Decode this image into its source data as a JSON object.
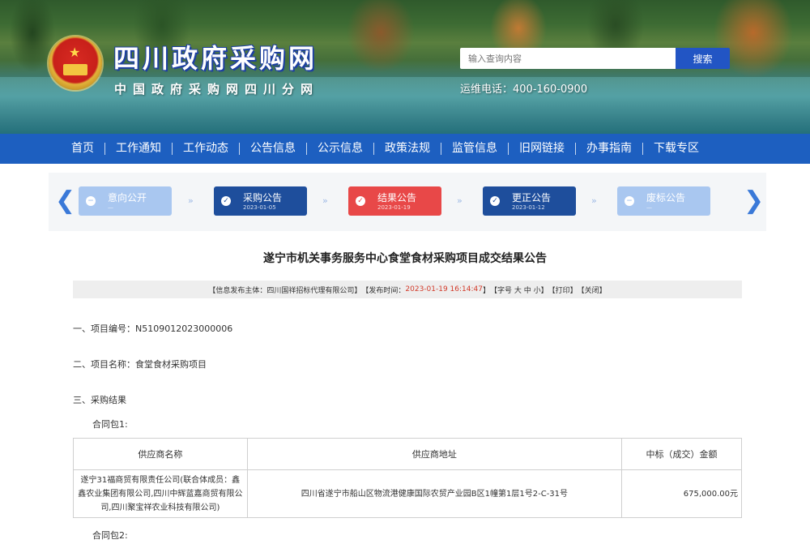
{
  "header": {
    "site_title": "四川政府采购网",
    "site_subtitle": "中国政府采购网四川分网",
    "search_placeholder": "输入查询内容",
    "search_button": "搜索",
    "hotline": "运维电话：400-160-0900"
  },
  "nav": {
    "items": [
      "首页",
      "工作通知",
      "工作动态",
      "公告信息",
      "公示信息",
      "政策法规",
      "监管信息",
      "旧网链接",
      "办事指南",
      "下载专区"
    ]
  },
  "steps": [
    {
      "label": "意向公开",
      "date": "—",
      "status": "gray"
    },
    {
      "label": "采购公告",
      "date": "2023-01-05",
      "status": "blue"
    },
    {
      "label": "结果公告",
      "date": "2023-01-19",
      "status": "red"
    },
    {
      "label": "更正公告",
      "date": "2023-01-12",
      "status": "blue"
    },
    {
      "label": "废标公告",
      "date": "—",
      "status": "gray"
    }
  ],
  "article": {
    "title": "遂宁市机关事务服务中心食堂食材采购项目成交结果公告",
    "info_publisher": "【信息发布主体：四川国祥招标代理有限公司】",
    "info_time_label": "【发布时间：",
    "info_time": "2023-01-19 16:14:47",
    "info_time_end": "】",
    "info_font": "【字号 大 中 小】",
    "info_print": "【打印】",
    "info_close": "【关闭】",
    "project_number": "一、项目编号：N5109012023000006",
    "project_name": "二、项目名称：食堂食材采购项目",
    "result_heading": "三、采购结果",
    "package1": "合同包1:",
    "package2": "合同包2:"
  },
  "result_table": {
    "headers": [
      "供应商名称",
      "供应商地址",
      "中标（成交）金额"
    ],
    "rows": [
      {
        "supplier": "遂宁31福商贸有限责任公司(联合体成员：鑫鑫农业集团有限公司,四川中辉蓝嘉商贸有限公司,四川聚宝祥农业科技有限公司)",
        "address": "四川省遂宁市船山区物流港健康国际农贸产业园B区1幢第1层1号2-C-31号",
        "amount": "675,000.00元"
      }
    ]
  }
}
